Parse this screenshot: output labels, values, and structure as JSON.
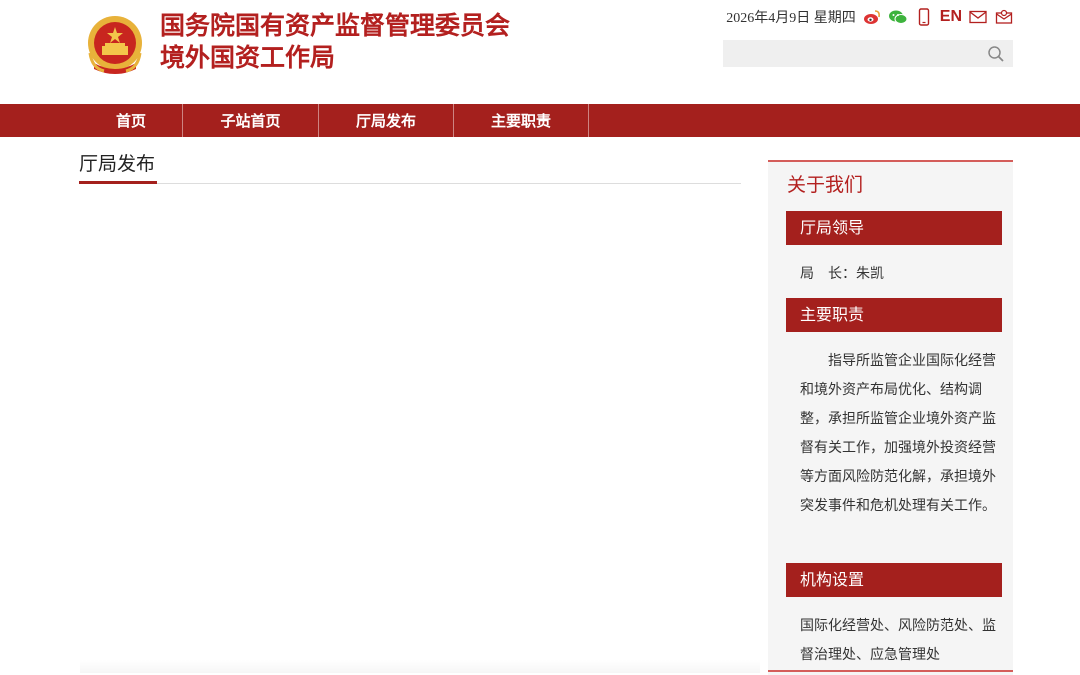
{
  "header": {
    "title_line1": "国务院国有资产监督管理委员会",
    "title_line2": "境外国资工作局",
    "date": "2026年4月9日 星期四",
    "en_label": "EN",
    "search_placeholder": "",
    "icons": [
      "weibo-icon",
      "wechat-icon",
      "mobile-icon",
      "mail-icon",
      "feedback-icon",
      "search-icon"
    ]
  },
  "nav": {
    "items": [
      "首页",
      "子站首页",
      "厅局发布",
      "主要职责"
    ]
  },
  "main": {
    "heading": "厅局发布"
  },
  "sidebar": {
    "title": "关于我们",
    "leaders_header": "厅局领导",
    "leader_text": "局　长：朱凯",
    "duties_header": "主要职责",
    "duties_text": "指导所监管企业国际化经营和境外资产布局优化、结构调整，承担所监管企业境外资产监督有关工作，加强境外投资经营等方面风险防范化解，承担境外突发事件和危机处理有关工作。",
    "org_header": "机构设置",
    "org_text": "国际化经营处、风险防范处、监督治理处、应急管理处"
  },
  "colors": {
    "brand_red": "#a4201d",
    "title_red": "#b3201f"
  }
}
